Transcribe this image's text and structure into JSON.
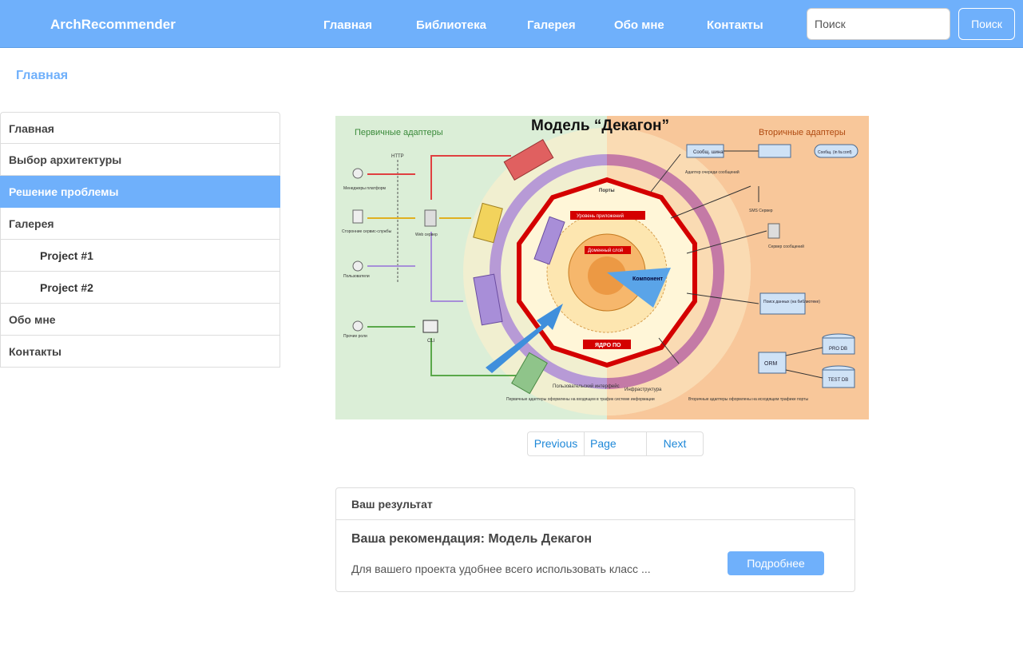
{
  "navbar": {
    "brand": "ArchRecommender",
    "links": [
      "Главная",
      "Библиотека",
      "Галерея",
      "Обо мне",
      "Контакты"
    ],
    "search_placeholder": "Поиск",
    "search_button": "Поиск"
  },
  "breadcrumb": "Главная",
  "sidebar": {
    "items": [
      {
        "label": "Главная"
      },
      {
        "label": "Выбор архитектуры"
      },
      {
        "label": "Решение проблемы",
        "active": true
      },
      {
        "label": "Галерея"
      },
      {
        "label": "Project #1"
      },
      {
        "label": "Project #2"
      },
      {
        "label": "Обо мне"
      },
      {
        "label": "Контакты"
      }
    ]
  },
  "diagram": {
    "title": "Модель “Декагон”",
    "left_heading": "Первичные адаптеры",
    "right_heading": "Вторичные адаптеры",
    "left_actors": [
      "Менеджеры платформ",
      "Сторонние сервис-службы",
      "Пользователи",
      "Прочие роли"
    ],
    "http_label": "HTTP",
    "web_server": "Web сервер",
    "cli": "CLI",
    "ports_label": "Порты",
    "core_label": "ЯДРО ПО",
    "app_services": "Уровень приложений",
    "domain_layer": "Доменный слой",
    "component": "Компонент",
    "right_items": [
      "Сообщ. шина",
      "Адаптер очереди сообщений",
      "Сообщ. (in fa.conf)",
      "SMS Сервер",
      "Сервер сообщений",
      "Поиск данных (на библиотеке)",
      "PRO DB",
      "TEST DB",
      "ORM"
    ],
    "bottom_left": "Пользовательский интерфейс",
    "bottom_center": "Инфраструктура",
    "footnote_left": "Первичные адаптеры оформлены на входящем в трафик системе информации",
    "footnote_right": "Вторичные адаптеры оформлены на исходящем трафике порты"
  },
  "pagination": {
    "previous": "Previous",
    "page": "Page",
    "next": "Next"
  },
  "result": {
    "header": "Ваш результат",
    "title": "Ваша рекомендация: Модель Декагон",
    "text": "Для вашего проекта удобнее всего использовать класс ...",
    "button": "Подробнее"
  },
  "colors": {
    "primary": "#6fb0fb",
    "link": "#1e88d8",
    "core_red": "#d40000",
    "ring_purple": "#b79ad6"
  }
}
